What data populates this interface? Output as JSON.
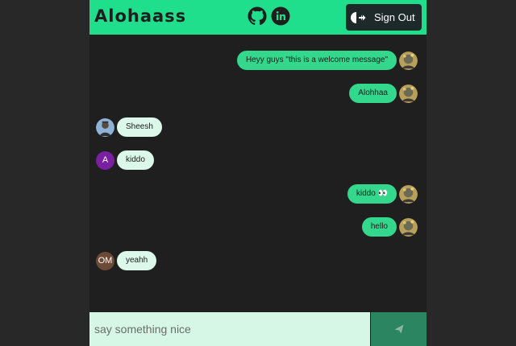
{
  "header": {
    "brand": "Alohaass",
    "github_icon": "github-icon",
    "linkedin_icon": "linkedin-icon",
    "signout_label": "Sign Out",
    "signout_icon": "sign-out-icon"
  },
  "messages": [
    {
      "side": "sent",
      "text": "Heyy guys \"this is a welcome message\"",
      "avatar": "photo"
    },
    {
      "side": "sent",
      "text": "Alohhaa",
      "avatar": "photo"
    },
    {
      "side": "recv",
      "text": "Sheesh",
      "avatar": "photo"
    },
    {
      "side": "recv",
      "text": "kiddo",
      "avatar": "A"
    },
    {
      "side": "sent",
      "text": "kiddo 👀",
      "avatar": "photo"
    },
    {
      "side": "sent",
      "text": "hello",
      "avatar": "photo"
    },
    {
      "side": "recv",
      "text": "yeahh",
      "avatar": "OM"
    }
  ],
  "composer": {
    "placeholder": "say something nice",
    "value": "",
    "send_icon": "paper-plane-icon"
  },
  "colors": {
    "accent": "#1fde8c",
    "sent_bubble": "#34d88d",
    "received_bubble": "#dbf8ea",
    "background": "#1f1f1f",
    "send_button": "#2a8560"
  }
}
